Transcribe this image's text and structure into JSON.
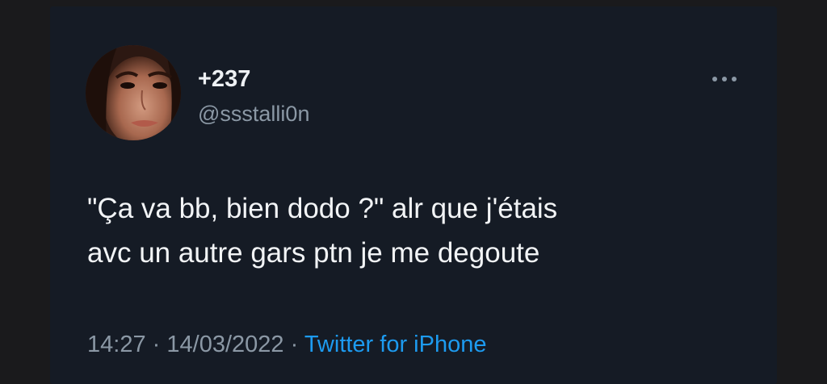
{
  "tweet": {
    "display_name": "+237",
    "handle": "@ssstalli0n",
    "text": "\"Ça va bb, bien dodo ?\" alr que j'étais\navc un autre gars ptn je me degoute",
    "time": "14:27",
    "separator": "·",
    "date": "14/03/2022",
    "source": "Twitter for iPhone",
    "more_icon": "more-horizontal-icon",
    "avatar": "profile-photo"
  },
  "colors": {
    "background": "#151b25",
    "primary_text": "#f2f4f6",
    "secondary_text": "#8b98a5",
    "link": "#1d9bf0"
  }
}
